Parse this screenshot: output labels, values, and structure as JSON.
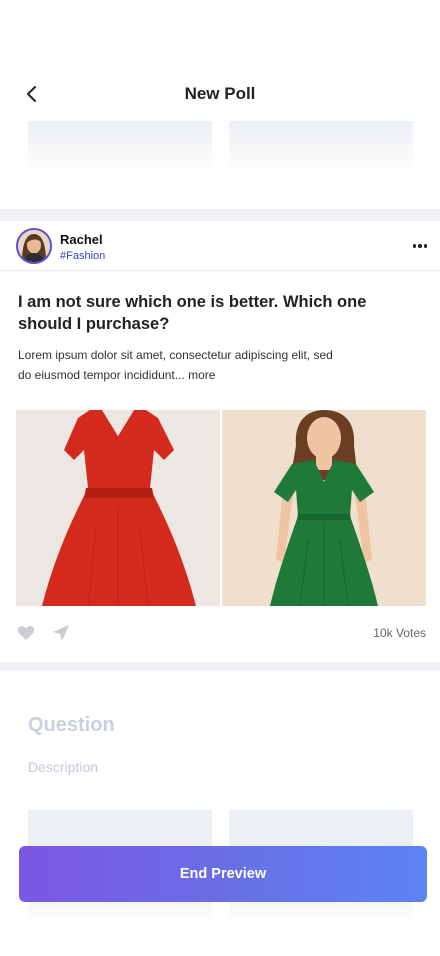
{
  "header": {
    "title": "New Poll",
    "back_icon": "chevron-left-icon"
  },
  "post": {
    "user": {
      "name": "Rachel",
      "hashtag": "#Fashion"
    },
    "question": "I am not sure which one is better. Which one should I purchase?",
    "description": "Lorem ipsum dolor sit amet, consectetur adipiscing elit, sed do eiusmod tempor incididunt...",
    "more_label": "more",
    "options": [
      {
        "label": "Red dress",
        "color": "#d9261c"
      },
      {
        "label": "Green dress",
        "color": "#1f7a3a"
      }
    ],
    "votes_count": "10k",
    "votes_label": "Votes",
    "icons": {
      "like": "heart-icon",
      "share": "send-icon",
      "menu": "more-horizontal-icon"
    }
  },
  "form": {
    "question_placeholder": "Question",
    "description_placeholder": "Description"
  },
  "actions": {
    "end_preview_label": "End Preview"
  },
  "colors": {
    "accent_start": "#7b57e4",
    "accent_end": "#5b84f4",
    "hashtag": "#3b3fb6",
    "divider": "#f0f2f5"
  }
}
